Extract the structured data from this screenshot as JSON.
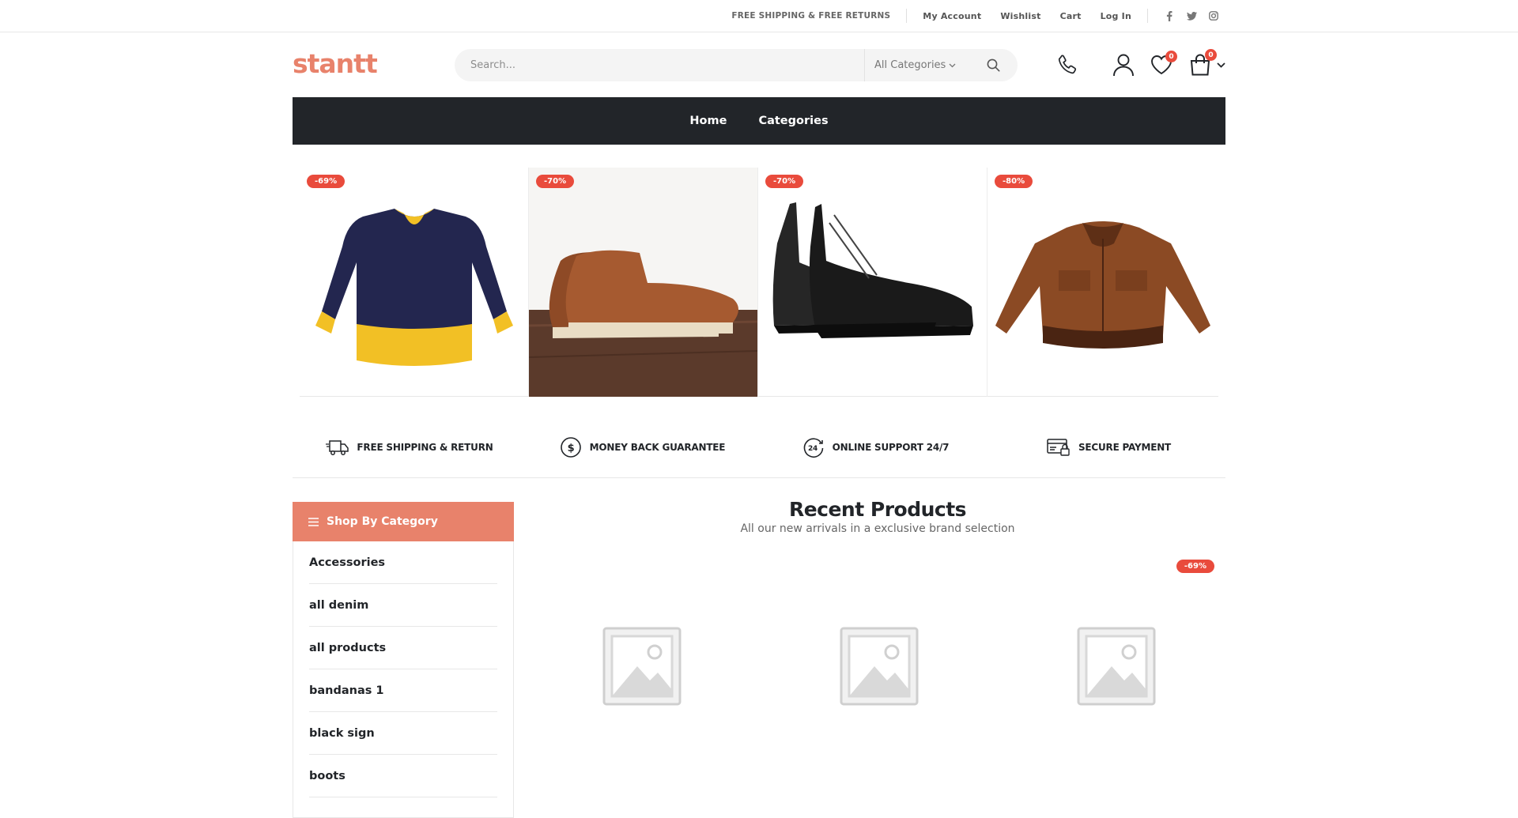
{
  "topbar": {
    "promo": "FREE SHIPPING & FREE RETURNS",
    "links": [
      "My Account",
      "Wishlist",
      "Cart",
      "Log In"
    ],
    "social": [
      "facebook-icon",
      "twitter-icon",
      "instagram-icon"
    ]
  },
  "header": {
    "logo": "stantt",
    "search_placeholder": "Search...",
    "category_select": "All Categories",
    "wishlist_count": "0",
    "cart_count": "0"
  },
  "nav": {
    "items": [
      "Home",
      "Categories"
    ]
  },
  "hero": {
    "products": [
      {
        "discount": "-69%",
        "image": "navy-sweatshirt"
      },
      {
        "discount": "-70%",
        "image": "brown-moc-toe-boots"
      },
      {
        "discount": "-70%",
        "image": "black-leather-boots"
      },
      {
        "discount": "-80%",
        "image": "brown-leather-jacket"
      }
    ]
  },
  "features": [
    {
      "label": "FREE SHIPPING & RETURN",
      "icon": "truck-icon"
    },
    {
      "label": "MONEY BACK GUARANTEE",
      "icon": "dollar-icon"
    },
    {
      "label": "ONLINE SUPPORT 24/7",
      "icon": "support-24-icon"
    },
    {
      "label": "SECURE PAYMENT",
      "icon": "secure-payment-icon"
    }
  ],
  "sidebar": {
    "title": "Shop By Category",
    "categories": [
      "Accessories",
      "all denim",
      "all products",
      "bandanas 1",
      "black sign",
      "boots"
    ]
  },
  "recent": {
    "title": "Recent Products",
    "subtitle": "All our new arrivals in a exclusive brand selection",
    "products": [
      {
        "discount": ""
      },
      {
        "discount": ""
      },
      {
        "discount": "-69%"
      }
    ]
  },
  "colors": {
    "accent": "#e8826b",
    "dark": "#222529",
    "badge": "#e94b3c"
  }
}
